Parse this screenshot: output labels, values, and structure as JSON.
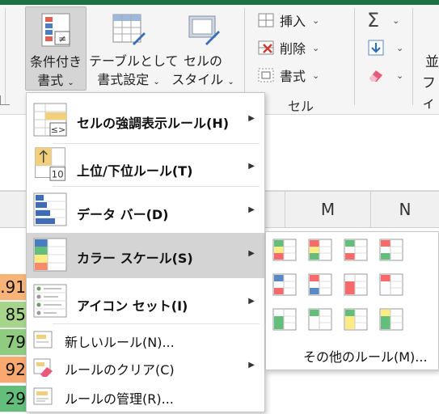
{
  "ribbon": {
    "conditional_formatting": {
      "line1": "条件付き",
      "line2": "書式",
      "caret": "⌄"
    },
    "format_as_table": {
      "line1": "テーブルとして",
      "line2": "書式設定",
      "caret": "⌄"
    },
    "cell_styles": {
      "line1": "セルの",
      "line2": "スタイル",
      "caret": "⌄"
    },
    "cells_group": {
      "insert": "挿入",
      "delete": "削除",
      "format": "書式",
      "group_label": "セル"
    },
    "editing": {
      "sort_partial_1": "並",
      "sort_partial_2": "フィ"
    }
  },
  "columns": [
    "M",
    "N"
  ],
  "left_cells": [
    {
      "text": ".91",
      "color": "#f8b477"
    },
    {
      "text": "85",
      "color": "#a6d48a"
    },
    {
      "text": "79",
      "color": "#8fcc80"
    },
    {
      "text": "92",
      "color": "#f9a870"
    },
    {
      "text": "29",
      "color": "#63be7b"
    }
  ],
  "menu": {
    "items": [
      {
        "label": "セルの強調表示ルール(H)",
        "icon": "highlight-rules-icon"
      },
      {
        "label": "上位/下位ルール(T)",
        "icon": "top-bottom-rules-icon",
        "icon_number": "10"
      },
      {
        "label": "データ バー(D)",
        "icon": "data-bars-icon"
      },
      {
        "label": "カラー スケール(S)",
        "icon": "color-scales-icon"
      },
      {
        "label": "アイコン セット(I)",
        "icon": "icon-sets-icon"
      }
    ],
    "small_items": [
      {
        "label": "新しいルール(N)...",
        "icon": "new-rule-icon"
      },
      {
        "label": "ルールのクリア(C)",
        "icon": "clear-rules-icon"
      },
      {
        "label": "ルールの管理(R)...",
        "icon": "manage-rules-icon"
      }
    ]
  },
  "color_scale_submenu": {
    "more_rules": "その他のルール(M)...",
    "scales": [
      [
        "#63be7b",
        "#ffeb84",
        "#f8696b"
      ],
      [
        "#f8696b",
        "#ffeb84",
        "#63be7b"
      ],
      [
        "#63be7b",
        "#fcfcff",
        "#f8696b"
      ],
      [
        "#f8696b",
        "#fcfcff",
        "#63be7b"
      ],
      [
        "#5a8ac6",
        "#fcfcff",
        "#f8696b"
      ],
      [
        "#f8696b",
        "#fcfcff",
        "#5a8ac6"
      ],
      [
        "#fcfcff",
        "#f8696b",
        "#f8696b"
      ],
      [
        "#f8696b",
        "#fcfcff",
        "#fcfcff"
      ],
      [
        "#fcfcff",
        "#63be7b",
        "#63be7b"
      ],
      [
        "#63be7b",
        "#fcfcff",
        "#fcfcff"
      ],
      [
        "#63be7b",
        "#ffeb84",
        "#ffeb84"
      ],
      [
        "#ffeb84",
        "#63be7b",
        "#63be7b"
      ]
    ]
  }
}
